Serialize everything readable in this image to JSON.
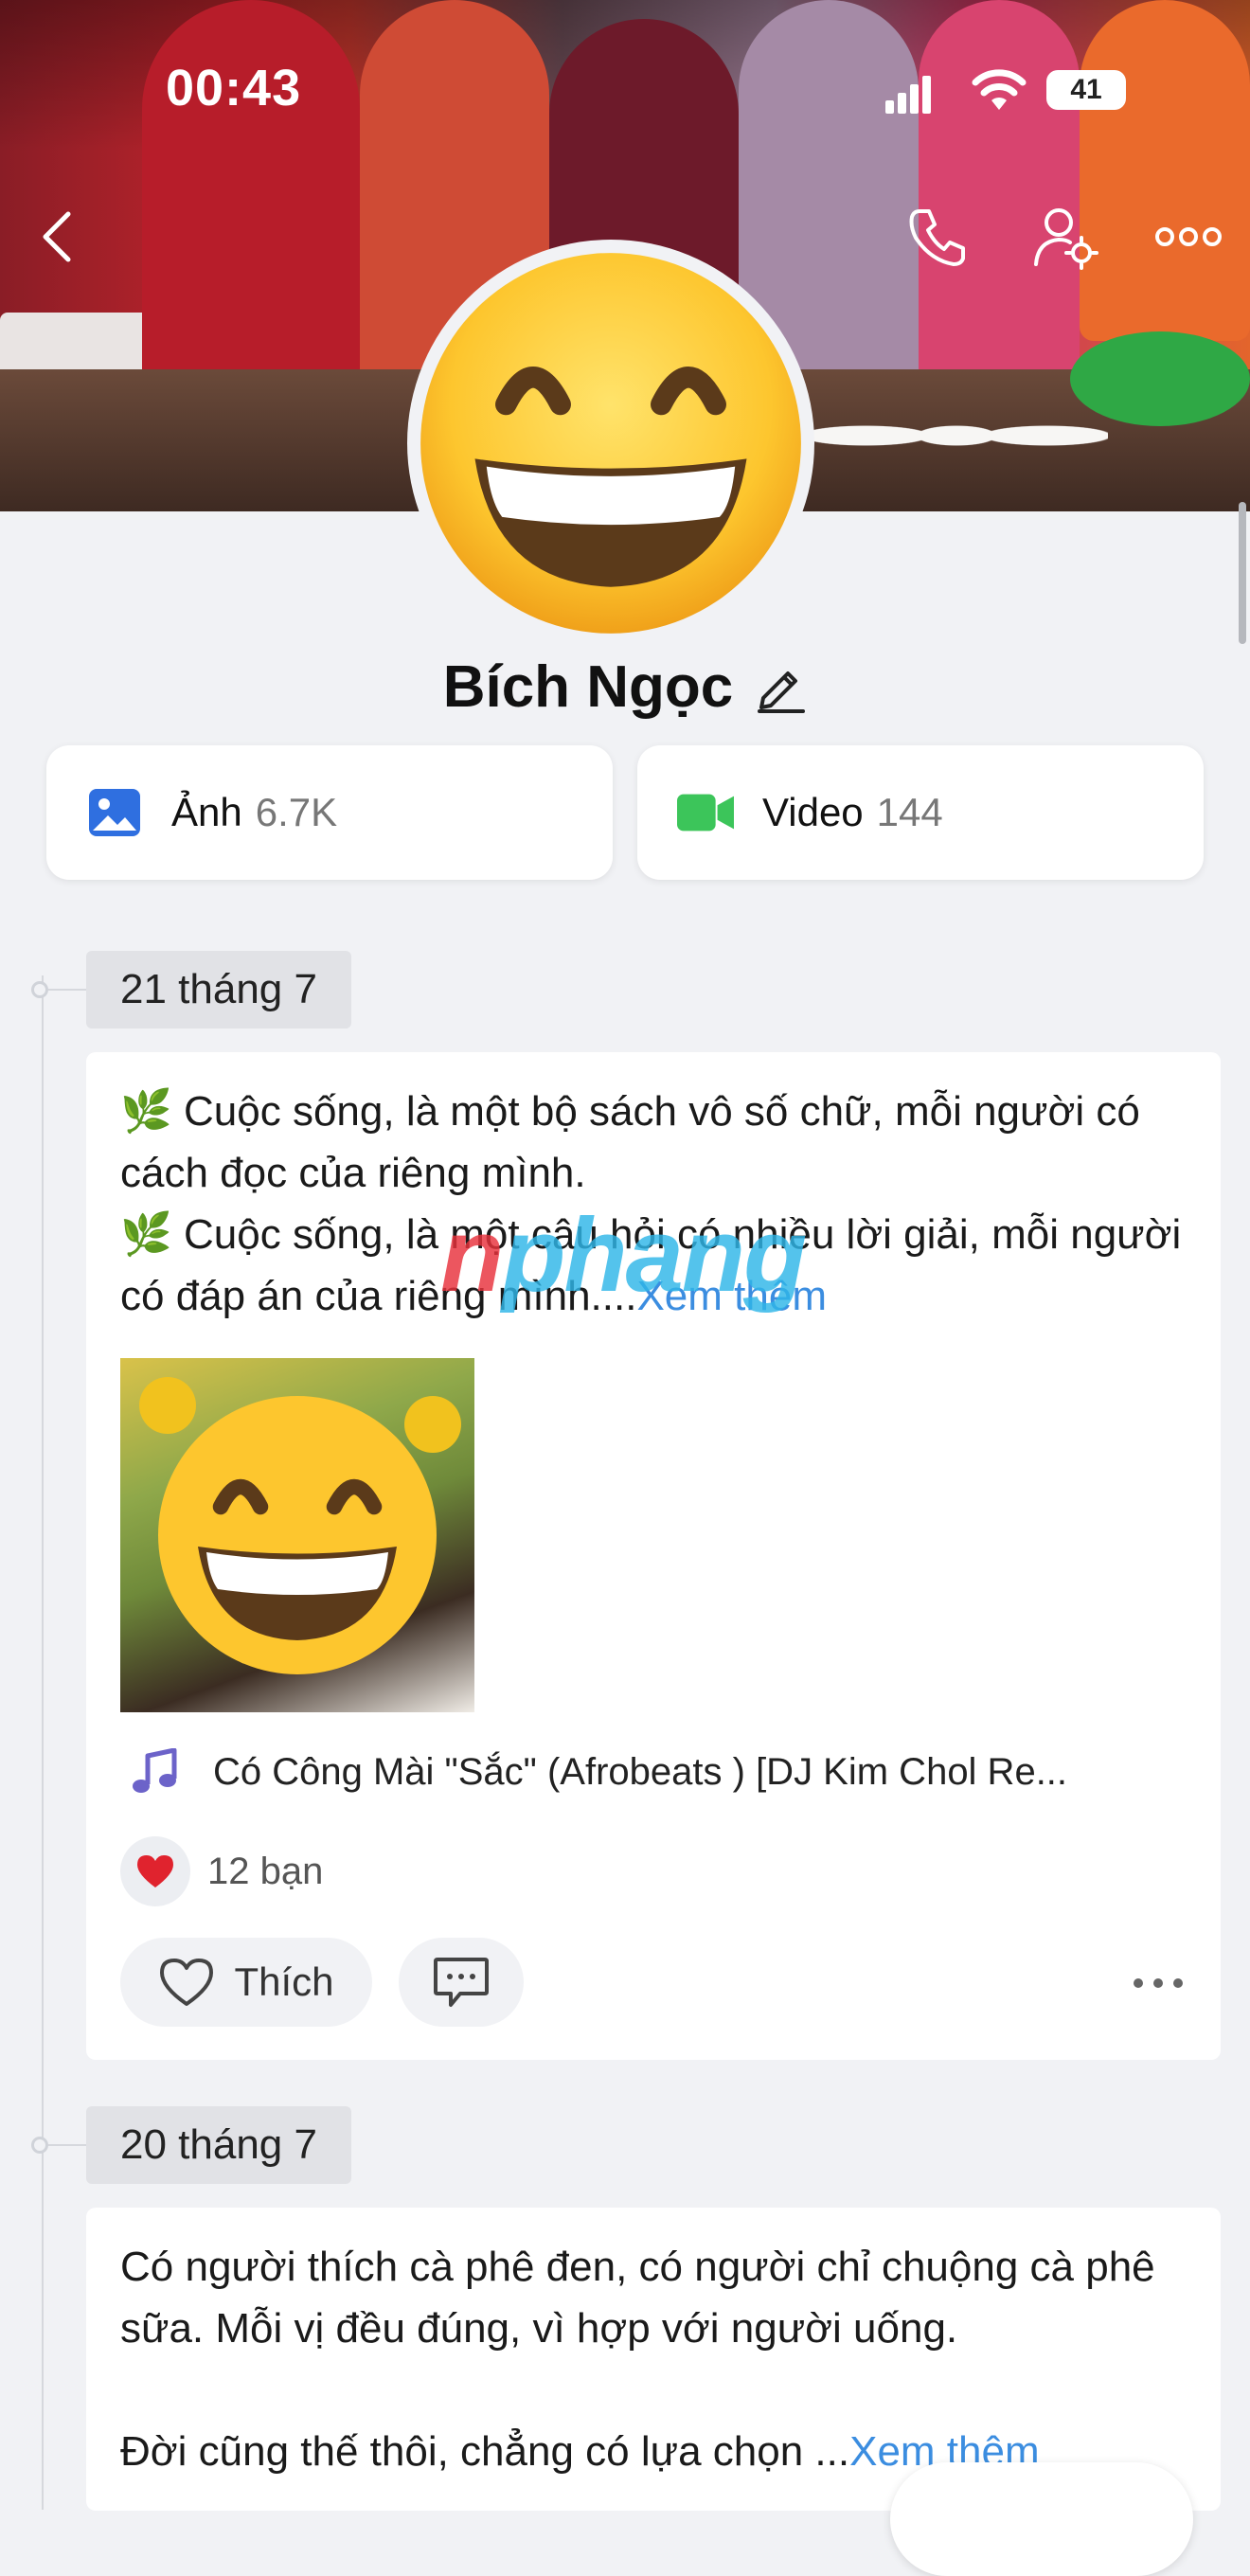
{
  "status_bar": {
    "time": "00:43",
    "battery": "41"
  },
  "profile": {
    "name": "Bích Ngọc",
    "media": {
      "photos_label": "Ảnh",
      "photos_count": "6.7K",
      "videos_label": "Video",
      "videos_count": "144"
    }
  },
  "posts": [
    {
      "date": "21 tháng 7",
      "text": "🌿 Cuộc sống, là một bộ sách vô số chữ, mỗi người có cách đọc của riêng mình.\n🌿 Cuộc sống, là một câu hỏi có nhiều lời giải, mỗi người có đáp án của riêng mình....",
      "see_more": "Xem thêm",
      "music": "Có Công Mài \"Sắc\" (Afrobeats ) [DJ Kim Chol Re...",
      "reactions": "12 bạn",
      "like_label": "Thích"
    },
    {
      "date": "20 tháng 7",
      "text": "Có người thích cà phê đen, có người chỉ chuộng cà phê sữa. Mỗi vị đều đúng, vì hợp với người uống.\n\nĐời cũng thế thôi, chẳng có lựa chọn ...",
      "see_more": "Xem thêm"
    }
  ],
  "watermark": {
    "part1": "n",
    "part2": "phang"
  },
  "colors": {
    "link": "#3b8de0",
    "photo_icon": "#2f6fe0",
    "video_icon": "#3cc55a",
    "music_icon": "#6c63c9",
    "heart": "#e0232e"
  },
  "icons": [
    "back-icon",
    "phone-icon",
    "user-settings-icon",
    "more-icon",
    "edit-icon",
    "photo-icon",
    "video-icon",
    "music-note-icon",
    "heart-icon",
    "like-icon",
    "comment-icon"
  ]
}
